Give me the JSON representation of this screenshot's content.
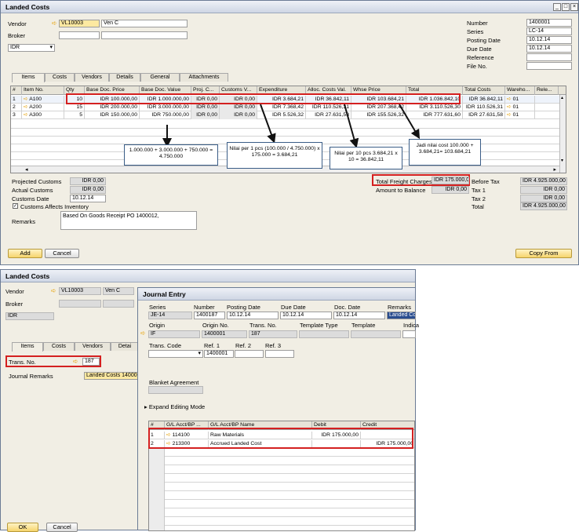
{
  "landed": {
    "title": "Landed Costs",
    "vendor_label": "Vendor",
    "vendor_code": "VL10003",
    "vendor_name": "Ven C",
    "broker_label": "Broker",
    "currency": "IDR",
    "number_label": "Number",
    "number": "1400001",
    "series_label": "Series",
    "series": "LC-14",
    "posting_label": "Posting Date",
    "posting": "10.12.14",
    "due_label": "Due Date",
    "due": "10.12.14",
    "ref_label": "Reference",
    "file_label": "File No.",
    "tabs": [
      "Items",
      "Costs",
      "Vendors",
      "Details",
      "General",
      "Attachments"
    ],
    "columns": [
      "#",
      "Item No.",
      "Qty",
      "Base Doc. Price",
      "Base Doc. Value",
      "Proj. C...",
      "Customs V...",
      "Expenditure",
      "Alloc. Costs Val.",
      "Whse Price",
      "Total",
      "Total Costs",
      "Wareho...",
      "Rele..."
    ],
    "rows": [
      [
        "1",
        "A100",
        "10",
        "IDR 100.000,00",
        "IDR 1.000.000,00",
        "IDR 0,00",
        "IDR 0,00",
        "IDR 3.684,21",
        "IDR 36.842,11",
        "IDR 103.684,21",
        "IDR 1.036.842,10",
        "IDR 36.842,11",
        "01"
      ],
      [
        "2",
        "A200",
        "15",
        "IDR 200.000,00",
        "IDR 3.000.000,00",
        "IDR 0,00",
        "IDR 0,00",
        "IDR 7.368,42",
        "IDR 110.526,31",
        "IDR 207.368,42",
        "IDR 3.110.526,30",
        "IDR 110.526,31",
        "01"
      ],
      [
        "3",
        "A300",
        "5",
        "IDR 150.000,00",
        "IDR 750.000,00",
        "IDR 0,00",
        "IDR 0,00",
        "IDR 5.526,32",
        "IDR 27.631,58",
        "IDR 155.526,32",
        "IDR 777.631,60",
        "IDR 27.631,58",
        "01"
      ]
    ],
    "callouts": {
      "sum": "1.000.000 + 3.000.000 + 750.000 = 4.750.000",
      "per1": "Nilai per 1 pcs (100.000 / 4.750.000) x 175.000 = 3.684,21",
      "per10": "Nilai per 10 pcs 3.684,21 x 10 = 36.842,11",
      "cost": "Jadi nilai cost 100.000 + 3.684,21= 103.684,21"
    },
    "projected_label": "Projected Customs",
    "projected": "IDR 0,00",
    "actual_label": "Actual Customs",
    "actual": "IDR 0,00",
    "customs_date_label": "Customs Date",
    "customs_date": "10.12.14",
    "affects_label": "Customs Affects Inventory",
    "remarks_label": "Remarks",
    "remarks": "Based On Goods Receipt PO 1400012,",
    "freight_label": "Total Freight Charges",
    "freight": "IDR 175.000,00",
    "balance_label": "Amount to Balance",
    "balance": "IDR 0,00",
    "before_tax_label": "Before Tax",
    "before_tax": "IDR 4.925.000,00",
    "tax1_label": "Tax 1",
    "tax1": "IDR 0,00",
    "tax2_label": "Tax 2",
    "tax2": "IDR 0,00",
    "total_label": "Total",
    "total": "IDR 4.925.000,00",
    "add": "Add",
    "cancel": "Cancel",
    "copy_from": "Copy From"
  },
  "landed2": {
    "title": "Landed Costs",
    "vendor_label": "Vendor",
    "vendor_code": "VL10003",
    "vendor_name": "Ven C",
    "broker_label": "Broker",
    "currency": "IDR",
    "tabs": [
      "Items",
      "Costs",
      "Vendors",
      "Detai"
    ],
    "trans_label": "Trans. No.",
    "trans": "187",
    "journal_label": "Journal Remarks",
    "journal": "Landed Costs 14000",
    "ok": "OK",
    "cancel": "Cancel"
  },
  "je": {
    "title": "Journal Entry",
    "series_label": "Series",
    "series": "JE-14",
    "number_label": "Number",
    "number": "1400187",
    "posting_label": "Posting Date",
    "posting": "10.12.14",
    "due_label": "Due Date",
    "due": "10.12.14",
    "doc_label": "Doc. Date",
    "doc": "10.12.14",
    "remarks_label": "Remarks",
    "remarks": "Landed Co",
    "origin_label": "Origin",
    "origin": "IF",
    "origin_no_label": "Origin No.",
    "origin_no": "1400001",
    "trans_label": "Trans. No.",
    "trans": "187",
    "template_type_label": "Template Type",
    "template_label": "Template",
    "indic_label": "Indica",
    "trans_code_label": "Trans. Code",
    "ref1_label": "Ref. 1",
    "ref1": "1400001",
    "ref2_label": "Ref. 2",
    "ref3_label": "Ref. 3",
    "blanket_label": "Blanket Agreement",
    "expand_label": "Expand Editing Mode",
    "columns": [
      "#",
      "G/L Acct/BP ...",
      "G/L Acct/BP Name",
      "Debit",
      "Credit"
    ],
    "rows": [
      [
        "1",
        "114100",
        "Raw  Materials",
        "IDR 175.000,00",
        ""
      ],
      [
        "2",
        "213300",
        "Accrued Landed Cost",
        "",
        "IDR 175.000,00"
      ]
    ]
  }
}
